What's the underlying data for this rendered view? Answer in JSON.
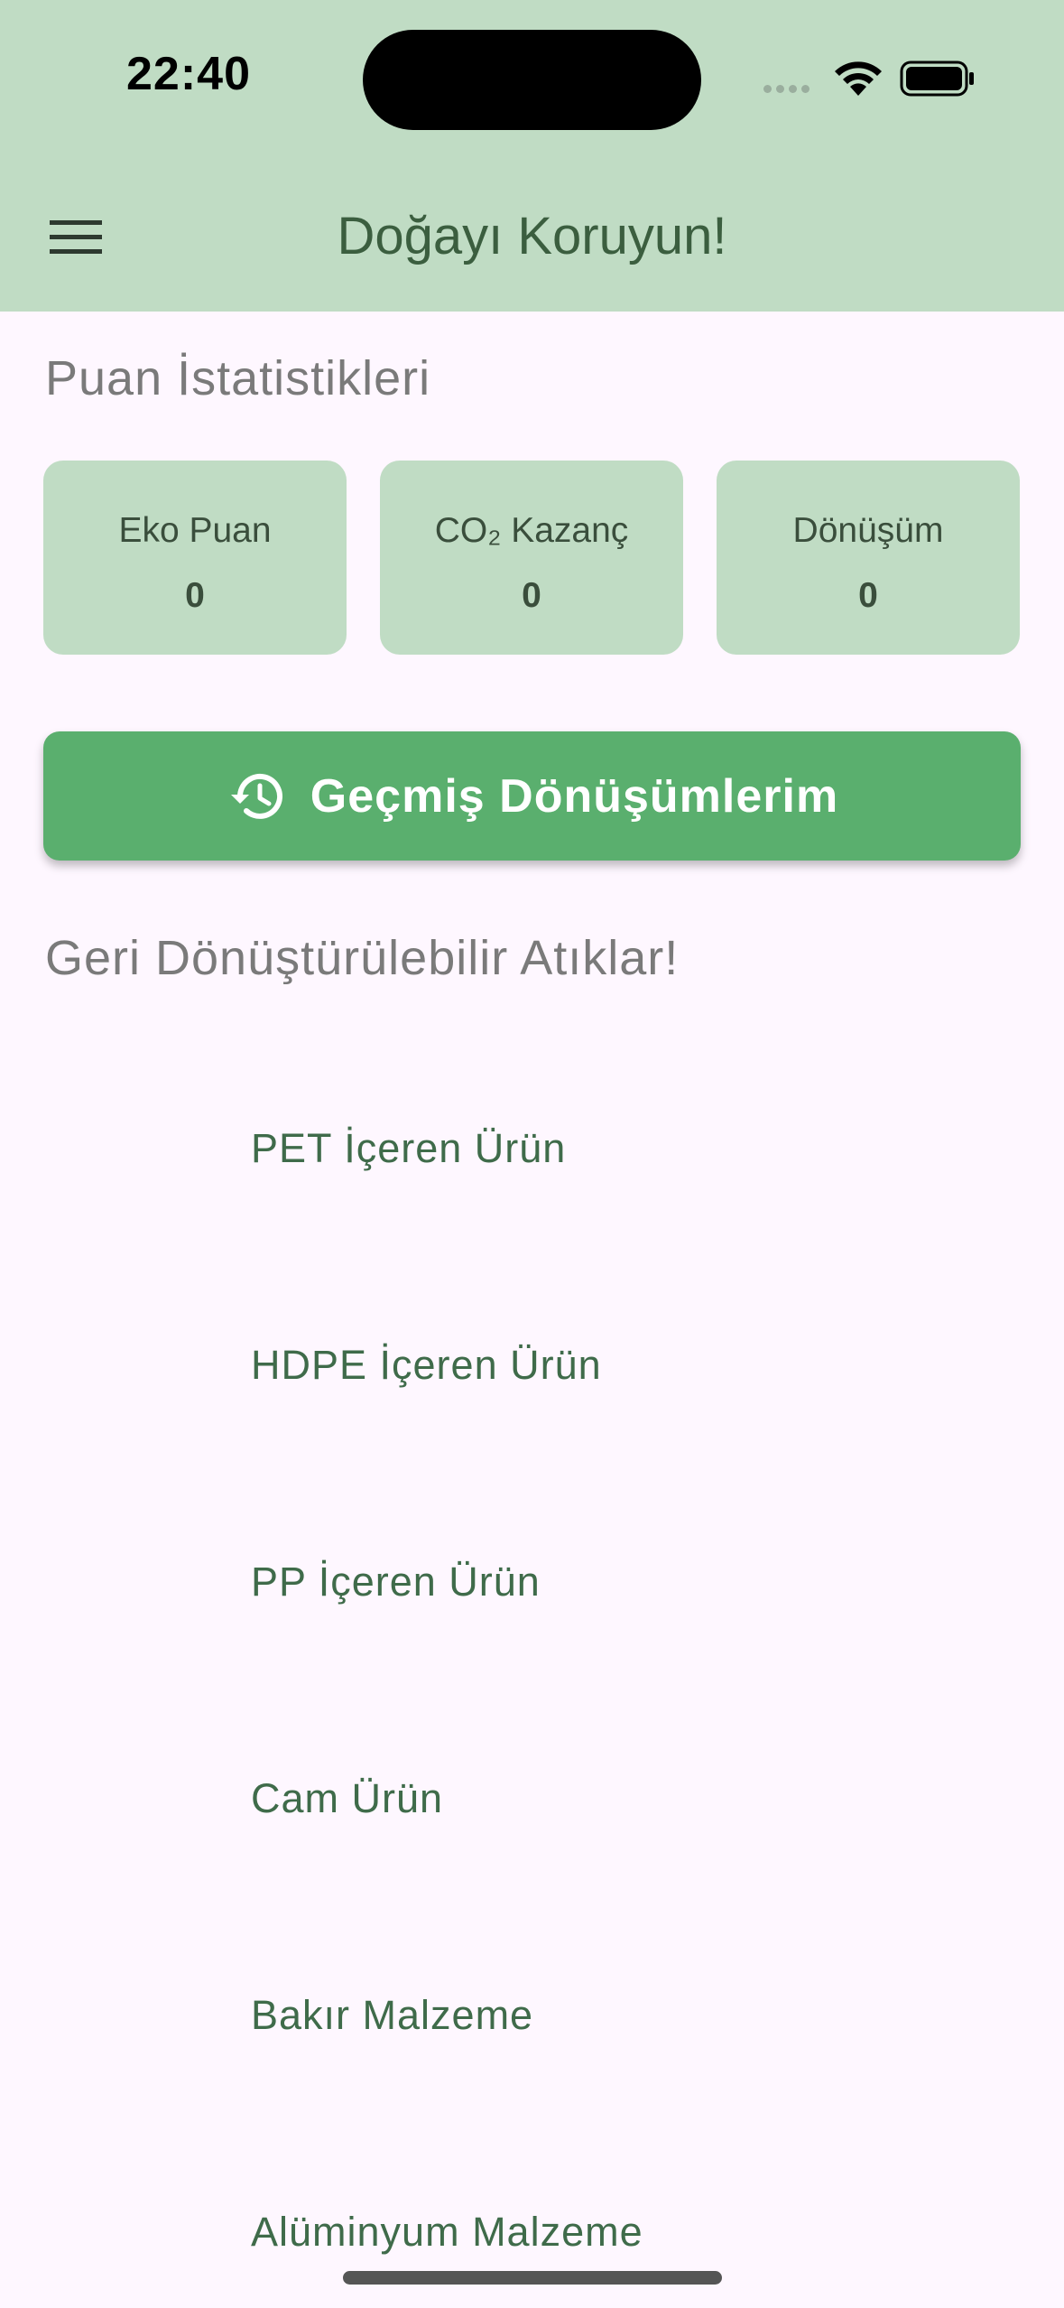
{
  "status_bar": {
    "time": "22:40"
  },
  "app_bar": {
    "title": "Doğayı Koruyun!"
  },
  "stats": {
    "title": "Puan İstatistikleri",
    "cards": [
      {
        "label": "Eko Puan",
        "value": "0"
      },
      {
        "label": "CO₂ Kazanç",
        "value": "0"
      },
      {
        "label": "Dönüşüm",
        "value": "0"
      }
    ]
  },
  "history_button": {
    "label": "Geçmiş Dönüşümlerim",
    "icon": "history-icon"
  },
  "waste": {
    "title": "Geri Dönüştürülebilir Atıklar!",
    "items": [
      "PET İçeren Ürün",
      "HDPE İçeren Ürün",
      "PP İçeren Ürün",
      "Cam Ürün",
      "Bakır Malzeme",
      "Alüminyum Malzeme"
    ]
  },
  "colors": {
    "header_bg": "#C0DCC4",
    "page_bg": "#FEF7FF",
    "accent": "#5AAF6E",
    "text_dark_green": "#3B5E3F"
  }
}
